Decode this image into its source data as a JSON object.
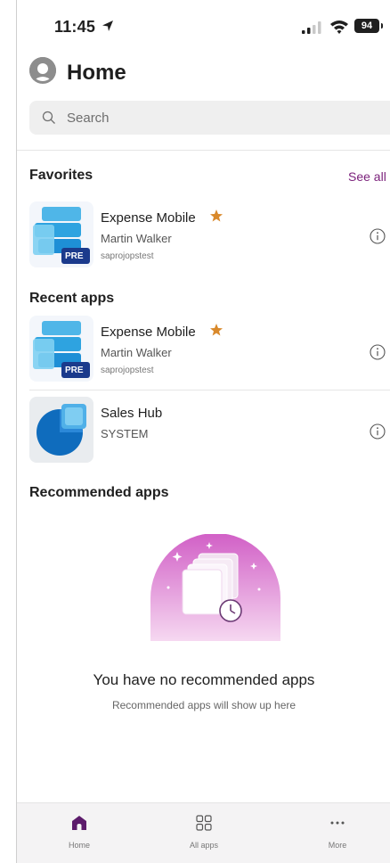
{
  "status_bar": {
    "time": "11:45",
    "battery": "94"
  },
  "header": {
    "title": "Home"
  },
  "search": {
    "placeholder": "Search"
  },
  "favorites": {
    "title": "Favorites",
    "see_all": "See all",
    "items": [
      {
        "name": "Expense Mobile",
        "owner": "Martin Walker",
        "environment": "saprojopstest",
        "badge": "PRE",
        "favorite": true
      }
    ]
  },
  "recent": {
    "title": "Recent apps",
    "items": [
      {
        "name": "Expense Mobile",
        "owner": "Martin Walker",
        "environment": "saprojopstest",
        "badge": "PRE",
        "favorite": true
      },
      {
        "name": "Sales Hub",
        "owner": "SYSTEM",
        "environment": "",
        "favorite": false
      }
    ]
  },
  "recommended": {
    "title": "Recommended apps",
    "empty_title": "You have no recommended apps",
    "empty_subtitle": "Recommended apps will show up here"
  },
  "bottom_nav": [
    {
      "label": "Home",
      "icon": "home-icon",
      "active": true
    },
    {
      "label": "All apps",
      "icon": "grid-icon",
      "active": false
    },
    {
      "label": "More",
      "icon": "more-icon",
      "active": false
    }
  ],
  "colors": {
    "accent": "#7a1f7a",
    "star": "#d9892b",
    "nav_active": "#5c1b6b"
  }
}
